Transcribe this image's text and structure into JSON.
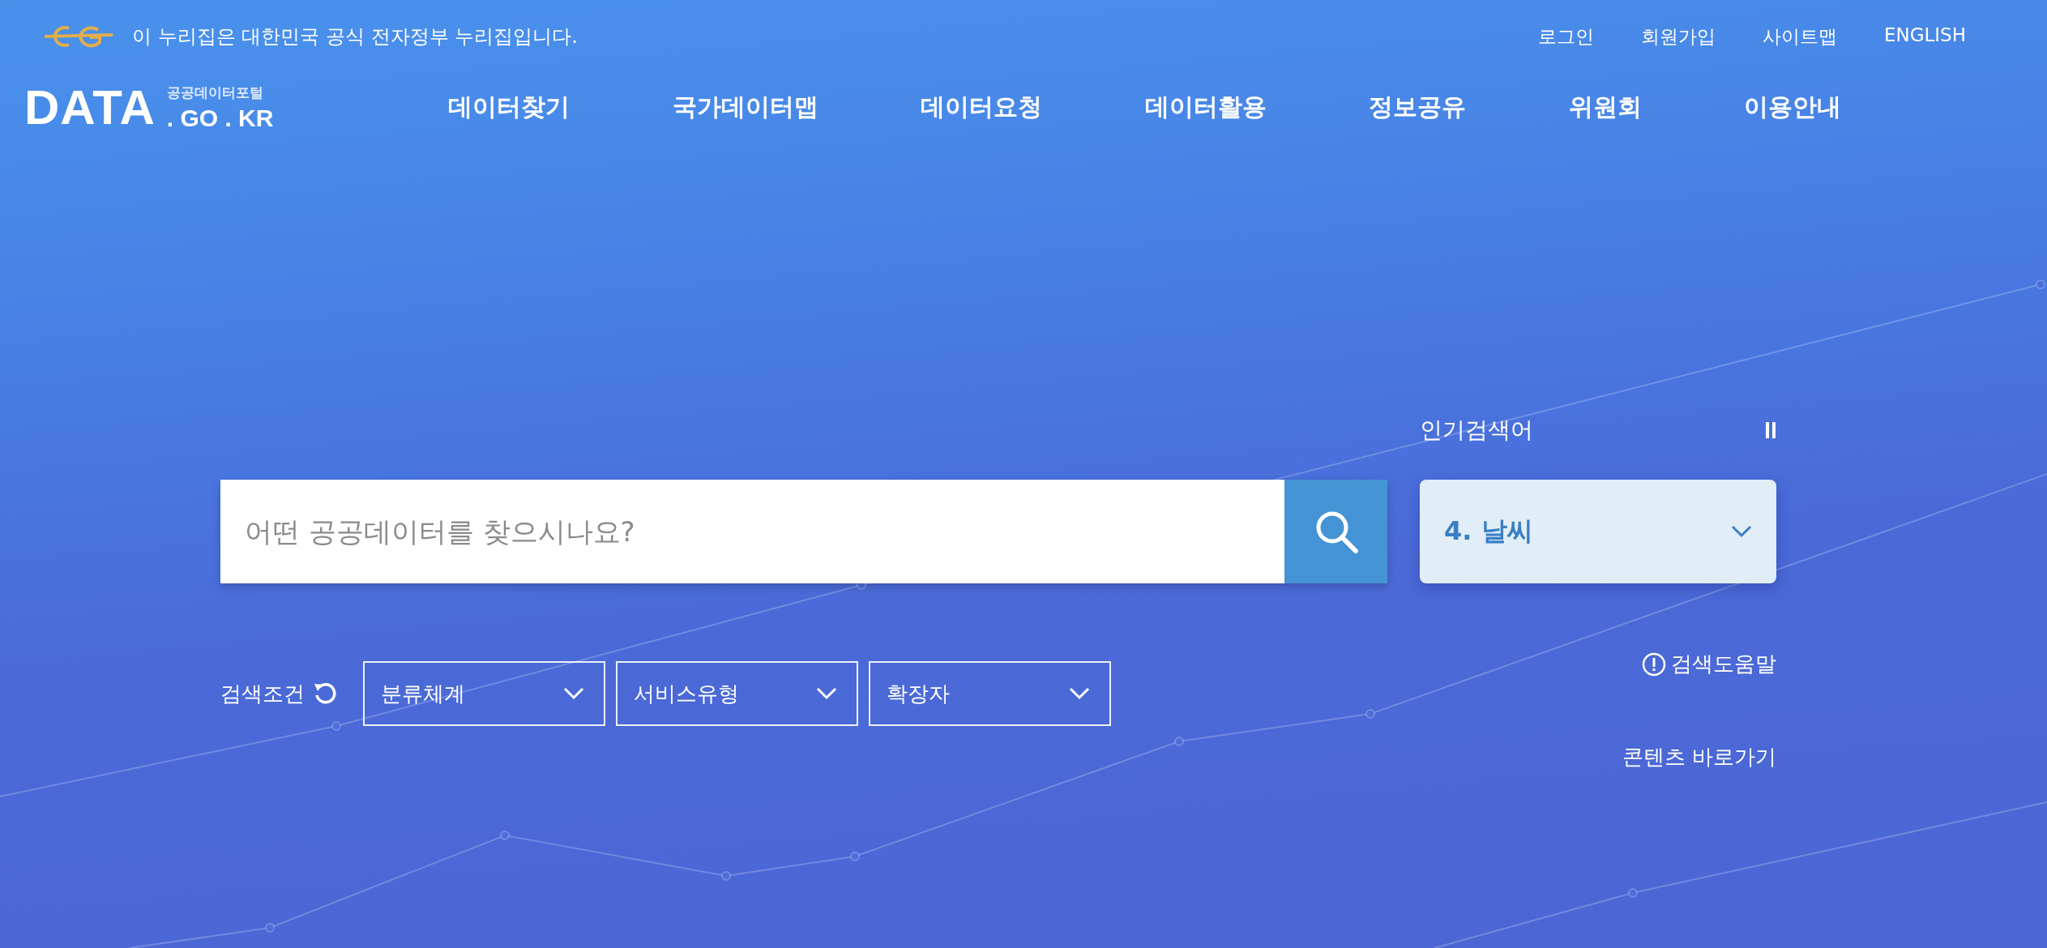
{
  "banner": {
    "text": "이 누리집은 대한민국 공식 전자정부 누리집입니다."
  },
  "top_links": [
    "로그인",
    "회원가입",
    "사이트맵",
    "ENGLISH"
  ],
  "logo": {
    "main": "DATA",
    "subtitle": "공공데이터포털",
    "domain": ". GO . KR"
  },
  "nav": [
    "데이터찾기",
    "국가데이터맵",
    "데이터요청",
    "데이터활용",
    "정보공유",
    "위원회",
    "이용안내"
  ],
  "search": {
    "placeholder": "어떤 공공데이터를 찾으시나요?"
  },
  "popular": {
    "title": "인기검색어",
    "current": "4. 날씨"
  },
  "filters": {
    "label": "검색조건",
    "dropdowns": [
      "분류체계",
      "서비스유형",
      "확장자"
    ]
  },
  "help_link": "검색도움말",
  "skip_link": "콘텐츠 바로가기"
}
